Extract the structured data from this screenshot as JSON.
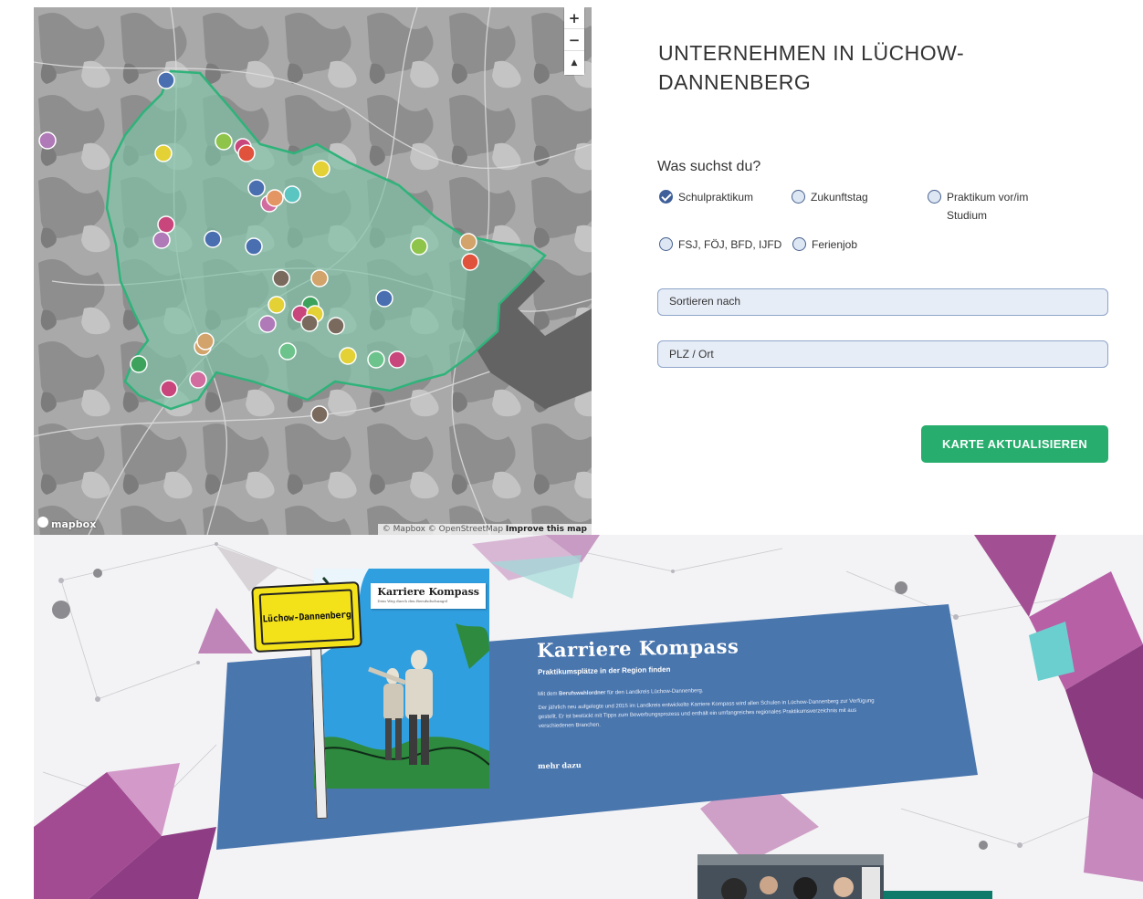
{
  "map": {
    "controls": {
      "zoom_in": "+",
      "zoom_out": "−",
      "compass": "▲"
    },
    "logo": "mapbox",
    "attribution": {
      "mapbox": "© Mapbox",
      "osm": "© OpenStreetMap",
      "improve": "Improve this map"
    },
    "colors": {
      "region_fill": "#7fc2a7",
      "region_stroke": "#2fb37a",
      "background": "#a9a9a9"
    },
    "markers": [
      {
        "color": "#4a6fb0"
      },
      {
        "color": "#b07ab8"
      },
      {
        "color": "#e3d135"
      },
      {
        "color": "#8fc44a"
      },
      {
        "color": "#c8467c"
      },
      {
        "color": "#e0523b"
      },
      {
        "color": "#4a6fb0"
      },
      {
        "color": "#d26d9f"
      },
      {
        "color": "#e39564"
      },
      {
        "color": "#5bc5c2"
      },
      {
        "color": "#e3d135"
      },
      {
        "color": "#c8467c"
      },
      {
        "color": "#b07ab8"
      },
      {
        "color": "#4a6fb0"
      },
      {
        "color": "#4a6fb0"
      },
      {
        "color": "#8fc44a"
      },
      {
        "color": "#d2a36b"
      },
      {
        "color": "#e0523b"
      },
      {
        "color": "#7a6a5e"
      },
      {
        "color": "#d2a36b"
      },
      {
        "color": "#e3d135"
      },
      {
        "color": "#3da35c"
      },
      {
        "color": "#4a6fb0"
      },
      {
        "color": "#b07ab8"
      },
      {
        "color": "#c8467c"
      },
      {
        "color": "#e3d135"
      },
      {
        "color": "#7a6a5e"
      },
      {
        "color": "#7a6a5e"
      },
      {
        "color": "#d2a36b"
      },
      {
        "color": "#6cc48c"
      },
      {
        "color": "#e3d135"
      },
      {
        "color": "#6cc48c"
      },
      {
        "color": "#c8467c"
      },
      {
        "color": "#3da35c"
      },
      {
        "color": "#c8467c"
      },
      {
        "color": "#d26d9f"
      },
      {
        "color": "#7a6a5e"
      },
      {
        "color": "#d2a36b"
      }
    ]
  },
  "panel": {
    "title": "UNTERNEHMEN IN LÜCHOW-DANNENBERG",
    "question": "Was suchst du?",
    "options": [
      {
        "label": "Schulpraktikum",
        "checked": true
      },
      {
        "label": "Zukunftstag",
        "checked": false
      },
      {
        "label": "Praktikum vor/im Studium",
        "checked": false
      },
      {
        "label": "FSJ, FÖJ, BFD, IJFD",
        "checked": false
      },
      {
        "label": "Ferienjob",
        "checked": false
      }
    ],
    "sort_label": "Sortieren nach",
    "location_placeholder": "PLZ / Ort",
    "update_button": "KARTE AKTUALISIEREN",
    "accent_color": "#27ad6d"
  },
  "banner": {
    "sign_text": "Lüchow-Dannenberg",
    "book_title": "Karriere Kompass",
    "book_subtitle": "Dein Weg durch den Berufsdschungel",
    "title": "Karriere Kompass",
    "subtitle": "Praktikumsplätze in der Region finden",
    "paragraph1_prefix": "Mit dem ",
    "paragraph1_bold": "Berufswahlordner",
    "paragraph1_suffix": " für den Landkreis Lüchow-Dannenberg.",
    "paragraph2": "Der jährlich neu aufgelegte und 2015 im Landkreis entwickelte Karriere Kompass wird allen Schulen in Lüchow-Dannenberg zur Verfügung gestellt. Er ist bestückt mit Tipps zum Bewerbungsprozess und enthält ein umfangreiches regionales Praktikumsverzeichnis mit aus verschiedenen Branchen.",
    "more_link": "mehr dazu",
    "card_color": "#4a76ae"
  }
}
